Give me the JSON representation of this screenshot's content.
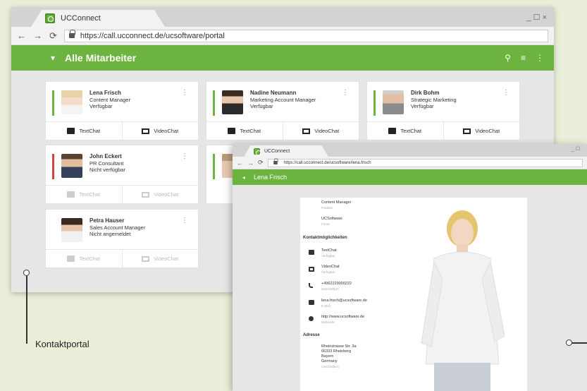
{
  "browser": {
    "tab_title": "UCConnect",
    "window_controls": "_ ☐ ×",
    "nav": {
      "back": "←",
      "forward": "→",
      "reload": "⟳"
    },
    "url": "https://call.ucconnect.de/ucsoftware/portal"
  },
  "portal": {
    "title": "Alle Mitarbeiter",
    "menu_glyph": "▾",
    "actions": {
      "search": "⚲",
      "filter": "≡",
      "more": "⋮"
    }
  },
  "contacts": [
    {
      "name": "Lena Frisch",
      "role": "Content Manager",
      "status": "Verfügbar",
      "status_color": "#6db33f",
      "text_chat": "TextChat",
      "video_chat": "VideoChat",
      "available": true
    },
    {
      "name": "Nadine Neumann",
      "role": "Marketing Account Manager",
      "status": "Verfügbar",
      "status_color": "#6db33f",
      "text_chat": "TextChat",
      "video_chat": "VideoChat",
      "available": true
    },
    {
      "name": "Dirk Bohm",
      "role": "Strategic Marketing",
      "status": "Verfügbar",
      "status_color": "#6db33f",
      "text_chat": "TextChat",
      "video_chat": "VideoChat",
      "available": true
    },
    {
      "name": "John Eckert",
      "role": "PR Consultant",
      "status": "Nicht verfügbar",
      "status_color": "#d0463c",
      "text_chat": "TextChat",
      "video_chat": "VideoChat",
      "available": false
    },
    {
      "name": "Petra Hauser",
      "role": "Sales Account Manager",
      "status": "Nicht angemeldet",
      "status_color": "#ffffff",
      "text_chat": "TextChat",
      "video_chat": "VideoChat",
      "available": false
    }
  ],
  "callout": {
    "label": "Kontaktportal"
  },
  "detail_window": {
    "tab_title": "UCConnect",
    "url": "https://call.ucconnect.de/ucsoftware/lena.frisch",
    "title": "Lena Frisch",
    "fields": [
      {
        "value": "Content Manager",
        "label": "Position"
      },
      {
        "value": "UCSoftware",
        "label": "Firma"
      }
    ],
    "contact_heading": "Kontaktmöglichkeiten",
    "contact_options": [
      {
        "icon": "chat-icon",
        "value": "TextChat",
        "label": "Verfügbar"
      },
      {
        "icon": "video-icon",
        "value": "VideoChat",
        "label": "Verfügbar"
      },
      {
        "icon": "phone-icon",
        "value": "+4962229000222",
        "label": "Geschäftlich"
      },
      {
        "icon": "mail-icon",
        "value": "lena.frisch@ucsoftware.de",
        "label": "E-Mail"
      },
      {
        "icon": "web-icon",
        "value": "http://www.ucsoftware.de",
        "label": "Webseite"
      }
    ],
    "address_heading": "Adresse",
    "address_lines": [
      "Rheinstrasse Str. 3a",
      "66333 Rheinberg",
      "Bayern",
      "Germany"
    ],
    "address_label": "Geschäftlich"
  }
}
